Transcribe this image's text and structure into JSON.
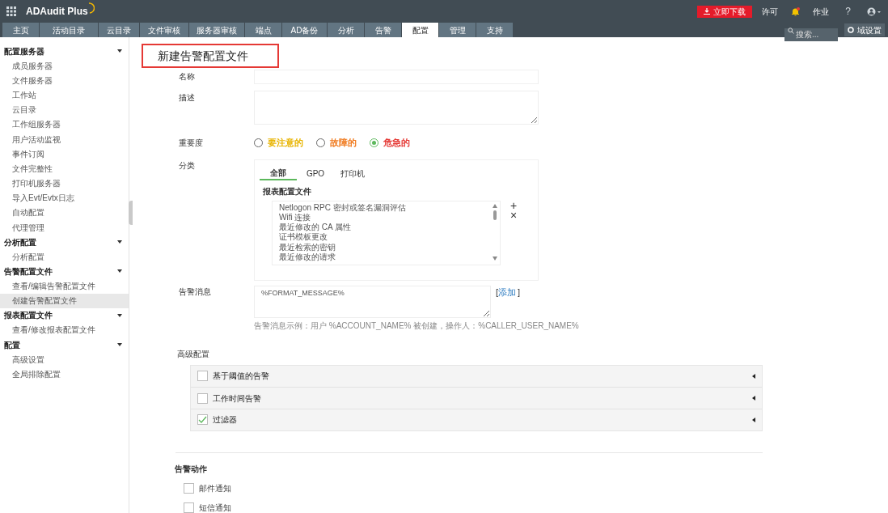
{
  "app": {
    "name": "ADAudit Plus"
  },
  "top_actions": {
    "download": "立即下载",
    "license": "许可",
    "jobs": "作业",
    "help": "?"
  },
  "tabs": [
    {
      "label": "主页",
      "selected": false
    },
    {
      "label": "活动目录",
      "selected": false
    },
    {
      "label": "云目录",
      "selected": false
    },
    {
      "label": "文件审核",
      "selected": false
    },
    {
      "label": "服务器审核",
      "selected": false
    },
    {
      "label": "端点",
      "selected": false
    },
    {
      "label": "AD备份",
      "selected": false
    },
    {
      "label": "分析",
      "selected": false
    },
    {
      "label": "告警",
      "selected": false
    },
    {
      "label": "配置",
      "selected": true
    },
    {
      "label": "管理",
      "selected": false
    },
    {
      "label": "支持",
      "selected": false
    }
  ],
  "search": {
    "placeholder": "搜索..."
  },
  "domain_settings": "域设置",
  "sidebar": [
    {
      "label": "配置服务器",
      "children": [
        {
          "label": "成员服务器",
          "selected": false
        },
        {
          "label": "文件服务器",
          "selected": false
        },
        {
          "label": "工作站",
          "selected": false
        },
        {
          "label": "云目录",
          "selected": false
        },
        {
          "label": "工作组服务器",
          "selected": false
        },
        {
          "label": "用户活动监视",
          "selected": false
        },
        {
          "label": "事件订阅",
          "selected": false
        },
        {
          "label": "文件完整性",
          "selected": false
        },
        {
          "label": "打印机服务器",
          "selected": false
        },
        {
          "label": "导入Evt/Evtx日志",
          "selected": false
        },
        {
          "label": "自动配置",
          "selected": false
        },
        {
          "label": "代理管理",
          "selected": false
        }
      ]
    },
    {
      "label": "分析配置",
      "children": [
        {
          "label": "分析配置",
          "selected": false
        }
      ]
    },
    {
      "label": "告警配置文件",
      "children": [
        {
          "label": "查看/编辑告警配置文件",
          "selected": false
        },
        {
          "label": "创建告警配置文件",
          "selected": true
        }
      ]
    },
    {
      "label": "报表配置文件",
      "children": [
        {
          "label": "查看/修改报表配置文件",
          "selected": false
        }
      ]
    },
    {
      "label": "配置",
      "children": [
        {
          "label": "高级设置",
          "selected": false
        },
        {
          "label": "全局排除配置",
          "selected": false
        }
      ]
    }
  ],
  "form": {
    "title": "新建告警配置文件",
    "name_label": "名称",
    "description_label": "描述",
    "severity_label": "重要度",
    "severities": [
      {
        "label": "要注意的",
        "color": "#e8b400",
        "selected": false
      },
      {
        "label": "故障的",
        "color": "#f07a1e",
        "selected": false
      },
      {
        "label": "危急的",
        "color": "#e53935",
        "selected": true
      }
    ],
    "category_label": "分类",
    "category_tabs": [
      {
        "label": "全部",
        "selected": true
      },
      {
        "label": "GPO",
        "selected": false
      },
      {
        "label": "打印机",
        "selected": false
      }
    ],
    "report_profiles_label": "报表配置文件",
    "report_profiles": [
      "Netlogon RPC 密封或签名漏洞评估",
      "Wifi 连接",
      "最近修改的 CA 属性",
      "证书模板更改",
      "最近检索的密钥",
      "最近修改的请求"
    ],
    "add_icon": "+",
    "remove_icon": "×",
    "message_label": "告警消息",
    "message_value": "%FORMAT_MESSAGE%",
    "message_add_link": "添加",
    "message_add_brackets": [
      "[",
      "]"
    ],
    "message_hint": "告警消息示例：用户 %ACCOUNT_NAME% 被创建，操作人：%CALLER_USER_NAME%",
    "advanced_label": "高级配置",
    "advanced": [
      {
        "label": "基于阈值的告警",
        "checked": false
      },
      {
        "label": "工作时间告警",
        "checked": false
      },
      {
        "label": "过滤器",
        "checked": true
      }
    ],
    "actions_label": "告警动作",
    "actions": [
      {
        "label": "邮件通知",
        "checked": false
      },
      {
        "label": "短信通知",
        "checked": false
      }
    ]
  }
}
